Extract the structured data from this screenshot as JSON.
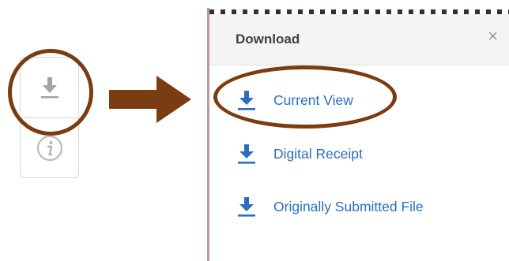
{
  "modal": {
    "title": "Download",
    "close_glyph": "×",
    "options": [
      {
        "label": "Current View",
        "icon": "download-icon"
      },
      {
        "label": "Digital Receipt",
        "icon": "download-icon"
      },
      {
        "label": "Originally Submitted File",
        "icon": "download-icon"
      }
    ]
  },
  "toolbar": {
    "items": [
      {
        "icon": "download-icon"
      },
      {
        "icon": "info-icon"
      }
    ]
  },
  "colors": {
    "annotation": "#7a3c10",
    "link": "#2a6ebd",
    "icon_gray": "#9a9a9a"
  }
}
